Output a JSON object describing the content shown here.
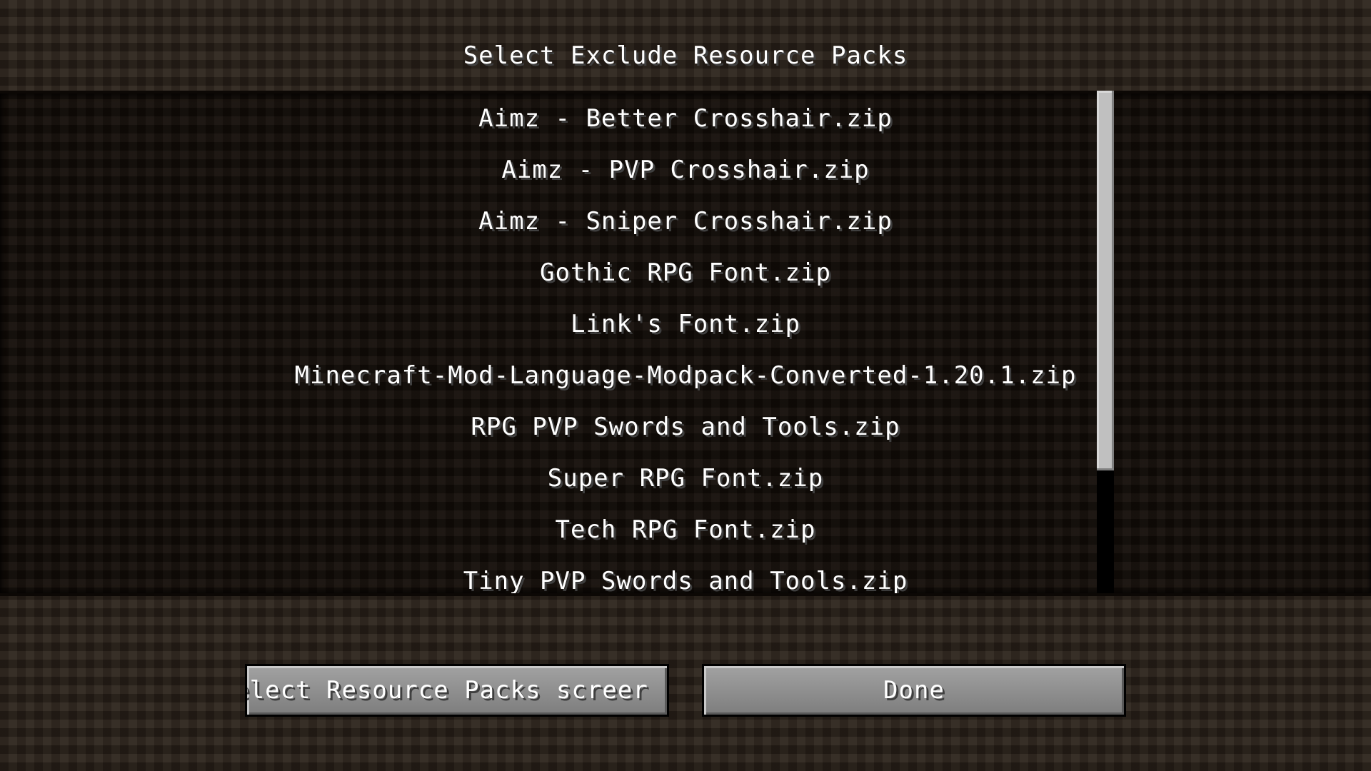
{
  "screen": {
    "title": "Select Exclude Resource Packs"
  },
  "pack_list": {
    "items": [
      "Aimz - Better Crosshair.zip",
      "Aimz - PVP Crosshair.zip",
      "Aimz - Sniper Crosshair.zip",
      "Gothic RPG Font.zip",
      "Link's Font.zip",
      "Minecraft-Mod-Language-Modpack-Converted-1.20.1.zip",
      "RPG PVP Swords and Tools.zip",
      "Super RPG Font.zip",
      "Tech RPG Font.zip",
      "Tiny PVP Swords and Tools.zip"
    ]
  },
  "buttons": {
    "select_screen_label": "elect Resource Packs screer",
    "done_label": "Done"
  },
  "colors": {
    "text": "#ffffff",
    "scrollbar_thumb": "#c0c0c0",
    "scrollbar_track": "#000000",
    "button_face": "#8f8f8f"
  }
}
